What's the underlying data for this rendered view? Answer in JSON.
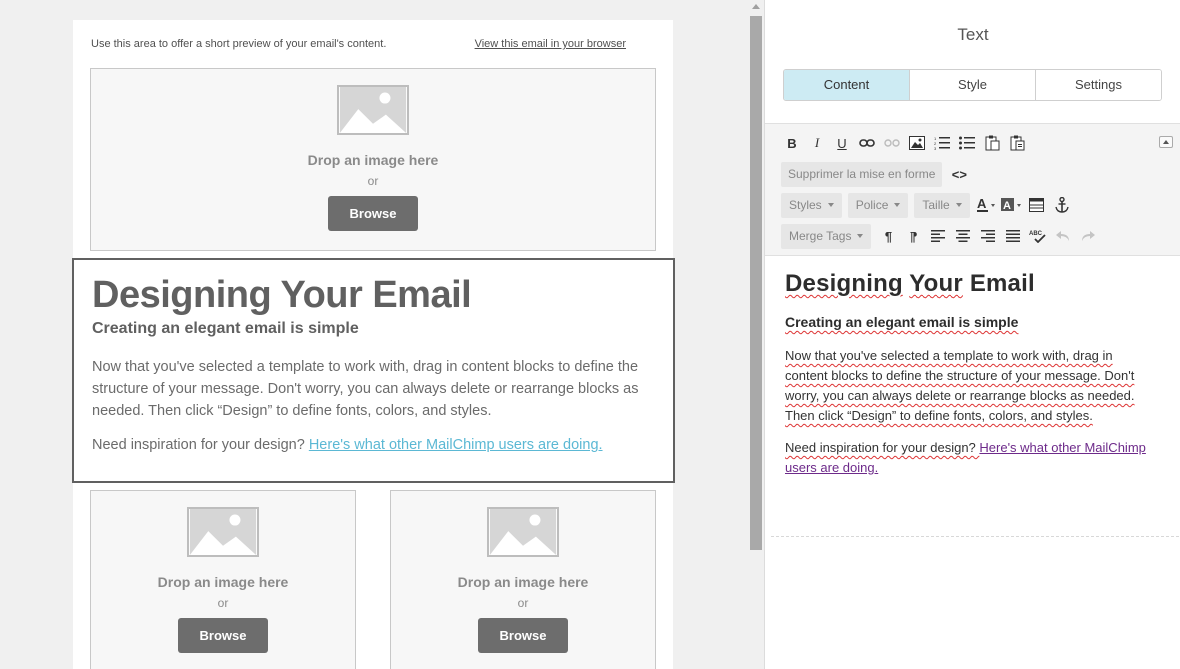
{
  "preheader": {
    "preview_text": "Use this area to offer a short preview of your email's content.",
    "browser_link": "View this email in your browser"
  },
  "image_blocks": {
    "drop_text": "Drop an image here",
    "or_text": "or",
    "browse_label": "Browse"
  },
  "text_block": {
    "heading": "Designing Your Email",
    "subheading": "Creating an elegant email is simple",
    "body": "Now that you've selected a template to work with, drag in content blocks to define the structure of your message. Don't worry, you can always delete or rearrange blocks as needed. Then click “Design” to define fonts, colors, and styles.",
    "inspire_prefix": "Need inspiration for your design? ",
    "inspire_link": "Here's what other MailChimp users are doing."
  },
  "panel": {
    "title": "Text",
    "tabs": [
      "Content",
      "Style",
      "Settings"
    ],
    "active_tab": "Content"
  },
  "toolbar": {
    "remove_format": "Supprimer la mise en forme",
    "source_label": "<>",
    "styles": "Styles",
    "font": "Police",
    "size": "Taille",
    "merge_tags": "Merge Tags",
    "bold": "B",
    "italic": "I",
    "underline": "U"
  },
  "editor": {
    "heading_words": [
      "Designing",
      "Your",
      "Email"
    ],
    "subheading": "Creating an elegant email is simple",
    "body_html_words": "Now that you've selected a template to work with, drag in content blocks to define the structure of your message. Don't worry, you can always delete or rearrange blocks as needed. Then click “Design” to define fonts, colors, and styles.",
    "inspire_prefix": "Need inspiration for your design? ",
    "inspire_link": "Here's what other MailChimp users are doing."
  },
  "colors": {
    "active_tab": "#cdebf3",
    "link_preview": "#5bb8d4",
    "link_editor": "#6d2a8a",
    "button": "#6d6d6d",
    "spellcheck": "#dd3333"
  }
}
